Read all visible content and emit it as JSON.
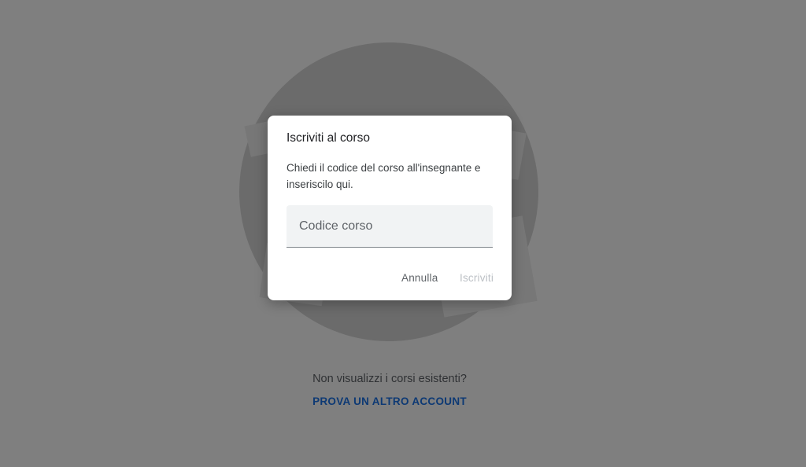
{
  "background": {
    "empty_state_text": "Non visualizzi i corsi esistenti?",
    "switch_account_link": "PROVA UN ALTRO ACCOUNT"
  },
  "dialog": {
    "title": "Iscriviti al corso",
    "body": "Chiedi il codice del corso all'insegnante e inseriscilo qui.",
    "input_value": "",
    "input_placeholder": "Codice corso",
    "cancel_label": "Annulla",
    "join_label": "Iscriviti",
    "join_enabled": false
  },
  "colors": {
    "link": "#1a73e8",
    "scrim": "rgba(0,0,0,0.5)",
    "disabled_button": "#bdc1c6"
  }
}
